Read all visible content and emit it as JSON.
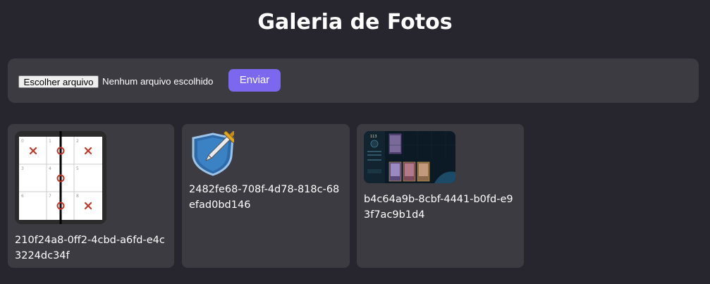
{
  "header": {
    "title": "Galeria de Fotos"
  },
  "upload": {
    "choose_file_label": "Escolher arquivo",
    "file_status": "Nenhum arquivo escolhido",
    "submit_label": "Enviar",
    "accent_color": "#7b68ee"
  },
  "gallery": {
    "items": [
      {
        "caption": "210f24a8-0ff2-4cbd-a6fd-e4c3224dc34f",
        "thumbnail": "tic-tac-toe-board-image",
        "board_cells": [
          "0",
          "1",
          "2",
          "3",
          "4",
          "5",
          "6",
          "7",
          "8"
        ]
      },
      {
        "caption": "2482fe68-708f-4d78-818c-68efad0bd146",
        "thumbnail": "shield-sword-icon"
      },
      {
        "caption": "b4c64a9b-8cbf-4441-b0fd-e93f7ac9b1d4",
        "thumbnail": "game-screenshot-image",
        "stat_value": "113"
      }
    ]
  }
}
